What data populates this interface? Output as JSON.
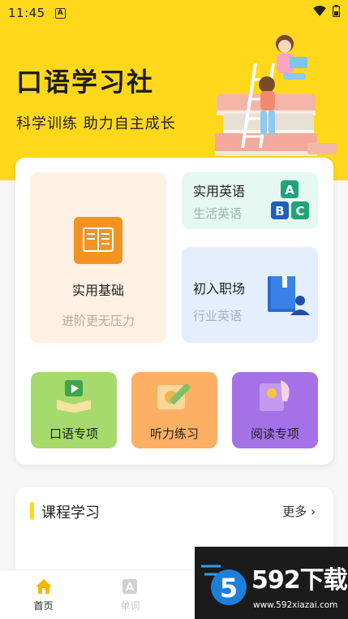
{
  "status_bar": {
    "time": "11:45",
    "notification_icon": "a-badge-icon",
    "wifi_icon": "wifi-icon",
    "battery_icon": "battery-icon"
  },
  "hero": {
    "title": "口语学习社",
    "subtitle": "科学训练  助力自主成长",
    "background_color": "#ffd81c",
    "illustration_icon": "kids-on-books-illustration"
  },
  "feature_tiles": {
    "basic": {
      "title": "实用基础",
      "subtitle": "进阶更无压力",
      "icon": "book-doc-icon"
    },
    "english": {
      "title": "实用英语",
      "subtitle": "生活英语",
      "icon": "abc-blocks-icon"
    },
    "workplace": {
      "title": "初入职场",
      "subtitle": "行业英语",
      "icon": "book-person-icon"
    }
  },
  "quick_tiles": [
    {
      "label": "口语专项",
      "icon": "video-book-icon",
      "color": "#a6da6c"
    },
    {
      "label": "听力练习",
      "icon": "scroll-pencil-icon",
      "color": "#fdb064"
    },
    {
      "label": "阅读专项",
      "icon": "book-quill-icon",
      "color": "#a472e6"
    }
  ],
  "course_section": {
    "title": "课程学习",
    "more_label": "更多"
  },
  "tab_bar": {
    "home_label": "首页",
    "words_label": "单词"
  },
  "watermark": {
    "brand": "592下载",
    "url": "www.592xiazai.com",
    "logo_icon": "592-logo-icon"
  }
}
